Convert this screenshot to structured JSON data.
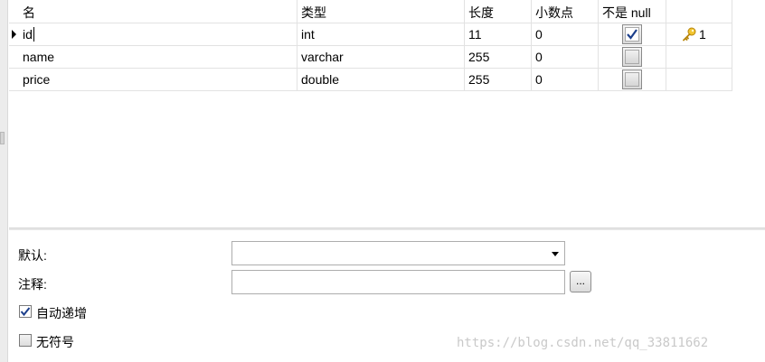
{
  "columns": {
    "name": "名",
    "type": "类型",
    "length": "长度",
    "decimals": "小数点",
    "not_null": "不是 null"
  },
  "rows": [
    {
      "name": "id",
      "type": "int",
      "length": "11",
      "decimals": "0",
      "not_null": true,
      "key": "1",
      "selected": true
    },
    {
      "name": "name",
      "type": "varchar",
      "length": "255",
      "decimals": "0",
      "not_null": false,
      "key": "",
      "selected": false
    },
    {
      "name": "price",
      "type": "double",
      "length": "255",
      "decimals": "0",
      "not_null": false,
      "key": "",
      "selected": false
    }
  ],
  "properties": {
    "default_label": "默认:",
    "default_value": "",
    "comment_label": "注释:",
    "comment_value": "",
    "ellipsis_label": "...",
    "auto_increment_label": "自动递增",
    "auto_increment_checked": true,
    "unsigned_label": "无符号",
    "unsigned_checked": false
  },
  "icons": {
    "row_indicator": "triangle-right-icon",
    "primary_key": "key-icon",
    "checkmark": "checkmark-icon",
    "dropdown": "chevron-down-icon"
  },
  "colors": {
    "key_gold": "#e0b010",
    "check_blue": "#1c3f8c"
  },
  "watermark": "https://blog.csdn.net/qq_33811662"
}
